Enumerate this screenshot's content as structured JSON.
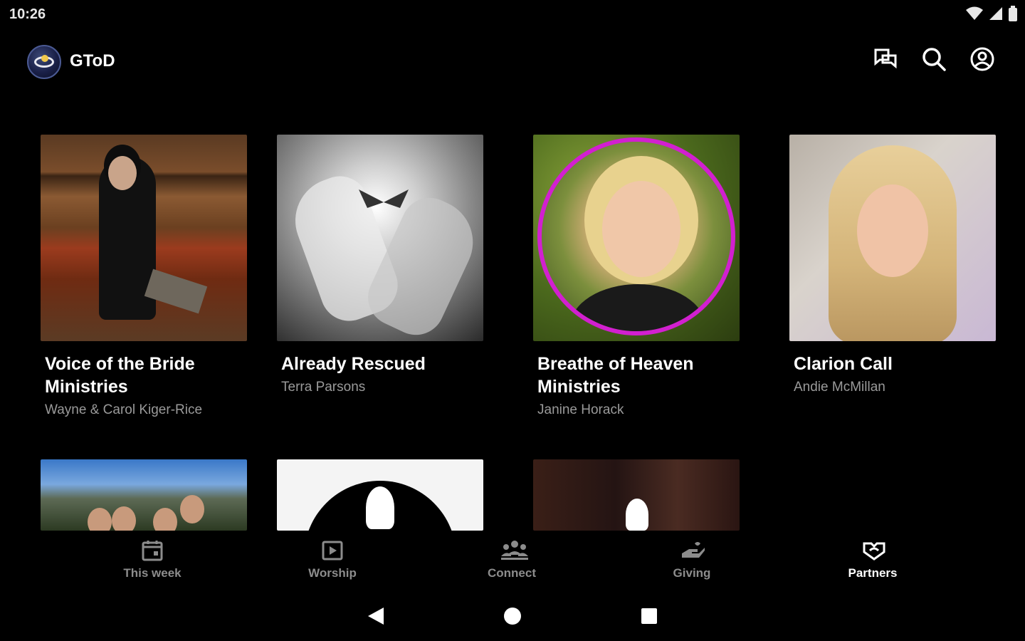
{
  "status_bar": {
    "time": "10:26"
  },
  "app_bar": {
    "title": "GToD",
    "actions": [
      "chat-icon",
      "search-icon",
      "account-icon"
    ]
  },
  "partners": [
    {
      "title": "Voice of the Bride Ministries",
      "subtitle": "Wayne & Carol Kiger-Rice"
    },
    {
      "title": "Already Rescued",
      "subtitle": "Terra Parsons"
    },
    {
      "title": "Breathe of Heaven Ministries",
      "subtitle": "Janine Horack"
    },
    {
      "title": "Clarion Call",
      "subtitle": "Andie McMillan"
    }
  ],
  "bottom_nav": {
    "items": [
      {
        "label": "This week",
        "icon": "calendar-icon"
      },
      {
        "label": "Worship",
        "icon": "play-box-icon"
      },
      {
        "label": "Connect",
        "icon": "people-icon"
      },
      {
        "label": "Giving",
        "icon": "giving-hand-icon"
      },
      {
        "label": "Partners",
        "icon": "handshake-heart-icon"
      }
    ],
    "active": "Partners"
  },
  "colors": {
    "background": "#000000",
    "inactive_label": "#8c8c8c",
    "active_label": "#ffffff",
    "subtitle": "#9a9a9a",
    "accent_ring": "#d21fd0"
  }
}
